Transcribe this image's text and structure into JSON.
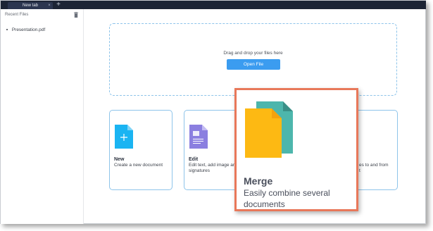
{
  "tabs": {
    "active_label": "New tab",
    "add_symbol": "+"
  },
  "sidebar": {
    "title": "Recent Files",
    "items": [
      {
        "label": "Presentation.pdf"
      }
    ]
  },
  "dropzone": {
    "prompt": "Drag and drop your files here",
    "button_label": "Open File"
  },
  "cards": {
    "new": {
      "title": "New",
      "desc": "Create a new document"
    },
    "edit": {
      "title": "Edit",
      "desc": "Edit text, add image and signatures"
    },
    "split_partial": {
      "desc": "es to and from\nt"
    }
  },
  "callout": {
    "title": "Merge",
    "desc": "Easily combine several documents"
  },
  "colors": {
    "accent": "#3b9cf0",
    "callout_border": "#e8785a",
    "merge_front": "#fdb913",
    "merge_back": "#4db6ac",
    "new_icon": "#1ab4f2",
    "edit_icon": "#8b7fe0"
  },
  "icons": {
    "trash": "trash-icon",
    "new": "new-document-icon",
    "edit": "edit-document-icon",
    "merge": "merge-documents-icon"
  }
}
